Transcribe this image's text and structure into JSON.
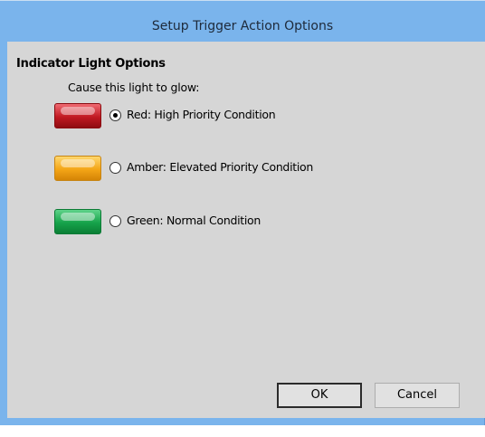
{
  "window": {
    "title": "Setup Trigger Action Options"
  },
  "group": {
    "title": "Indicator Light Options",
    "instruction": "Cause this light to glow:"
  },
  "options": [
    {
      "label": "Red: High Priority Condition",
      "color": "#c11a22",
      "selected": true
    },
    {
      "label": "Amber: Elevated Priority Condition",
      "color": "#f4a516",
      "selected": false
    },
    {
      "label": "Green: Normal Condition",
      "color": "#16a34a",
      "selected": false
    }
  ],
  "buttons": {
    "ok": "OK",
    "cancel": "Cancel"
  },
  "theme": {
    "titlebar": "#7ab4ec",
    "client": "#d6d6d6"
  }
}
